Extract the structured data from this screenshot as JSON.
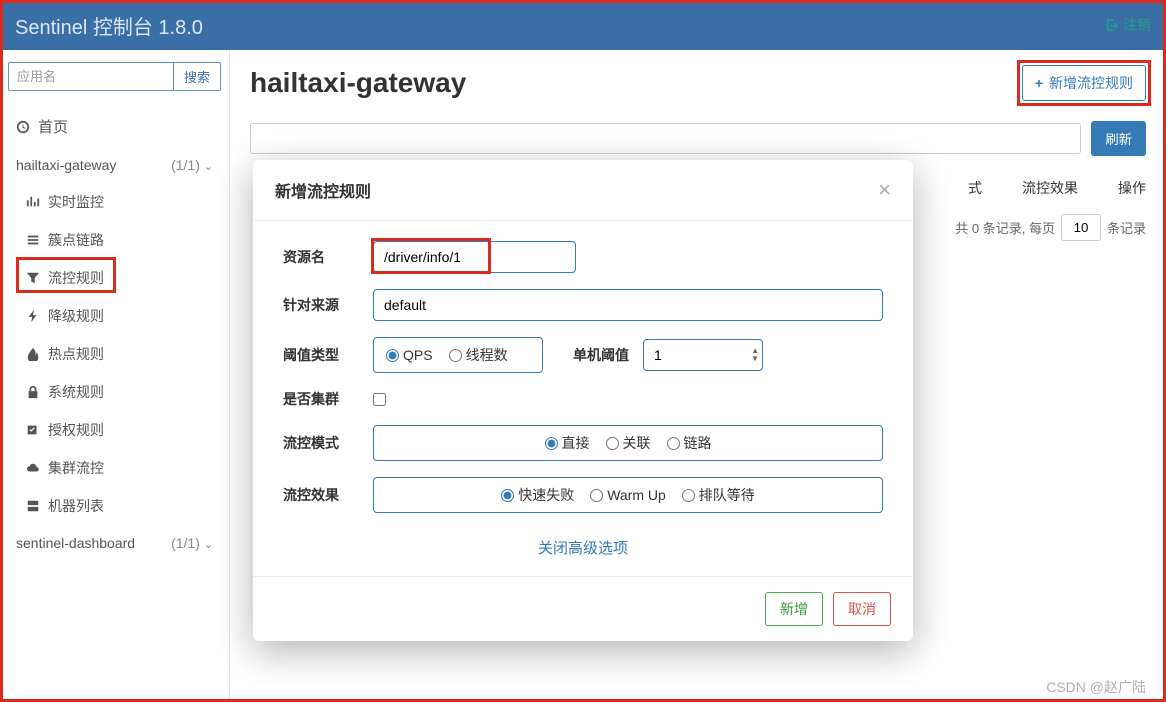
{
  "navbar": {
    "title": "Sentinel 控制台 1.8.0",
    "register": "注销"
  },
  "sidebar": {
    "search_placeholder": "应用名",
    "search_btn": "搜索",
    "home": "首页",
    "apps": [
      {
        "name": "hailtaxi-gateway",
        "count": "(1/1)"
      },
      {
        "name": "sentinel-dashboard",
        "count": "(1/1)"
      }
    ],
    "menu": {
      "realtime": "实时监控",
      "cluster_link": "簇点链路",
      "flow_rule": "流控规则",
      "degrade": "降级规则",
      "hotspot": "热点规则",
      "system": "系统规则",
      "auth": "授权规则",
      "cluster_flow": "集群流控",
      "machine": "机器列表"
    }
  },
  "page": {
    "title": "hailtaxi-gateway",
    "add_btn": "新增流控规则",
    "refresh": "刷新",
    "table_cols": {
      "mode": "式",
      "effect": "流控效果",
      "ops": "操作"
    },
    "pagination": {
      "prefix": "0 条记录, 每页",
      "value": "10",
      "suffix": "条记录"
    }
  },
  "modal": {
    "title": "新增流控规则",
    "labels": {
      "resource": "资源名",
      "source": "针对来源",
      "threshold_type": "阈值类型",
      "single_threshold": "单机阈值",
      "is_cluster": "是否集群",
      "mode": "流控模式",
      "effect": "流控效果"
    },
    "values": {
      "resource": "/driver/info/1",
      "source": "default",
      "threshold": "1"
    },
    "radios": {
      "qps": "QPS",
      "thread": "线程数",
      "direct": "直接",
      "relate": "关联",
      "chain": "链路",
      "fast_fail": "快速失败",
      "warmup": "Warm Up",
      "queue": "排队等待"
    },
    "advanced": "关闭高级选项",
    "ok": "新增",
    "cancel": "取消"
  },
  "watermark": "CSDN @赵广陆"
}
